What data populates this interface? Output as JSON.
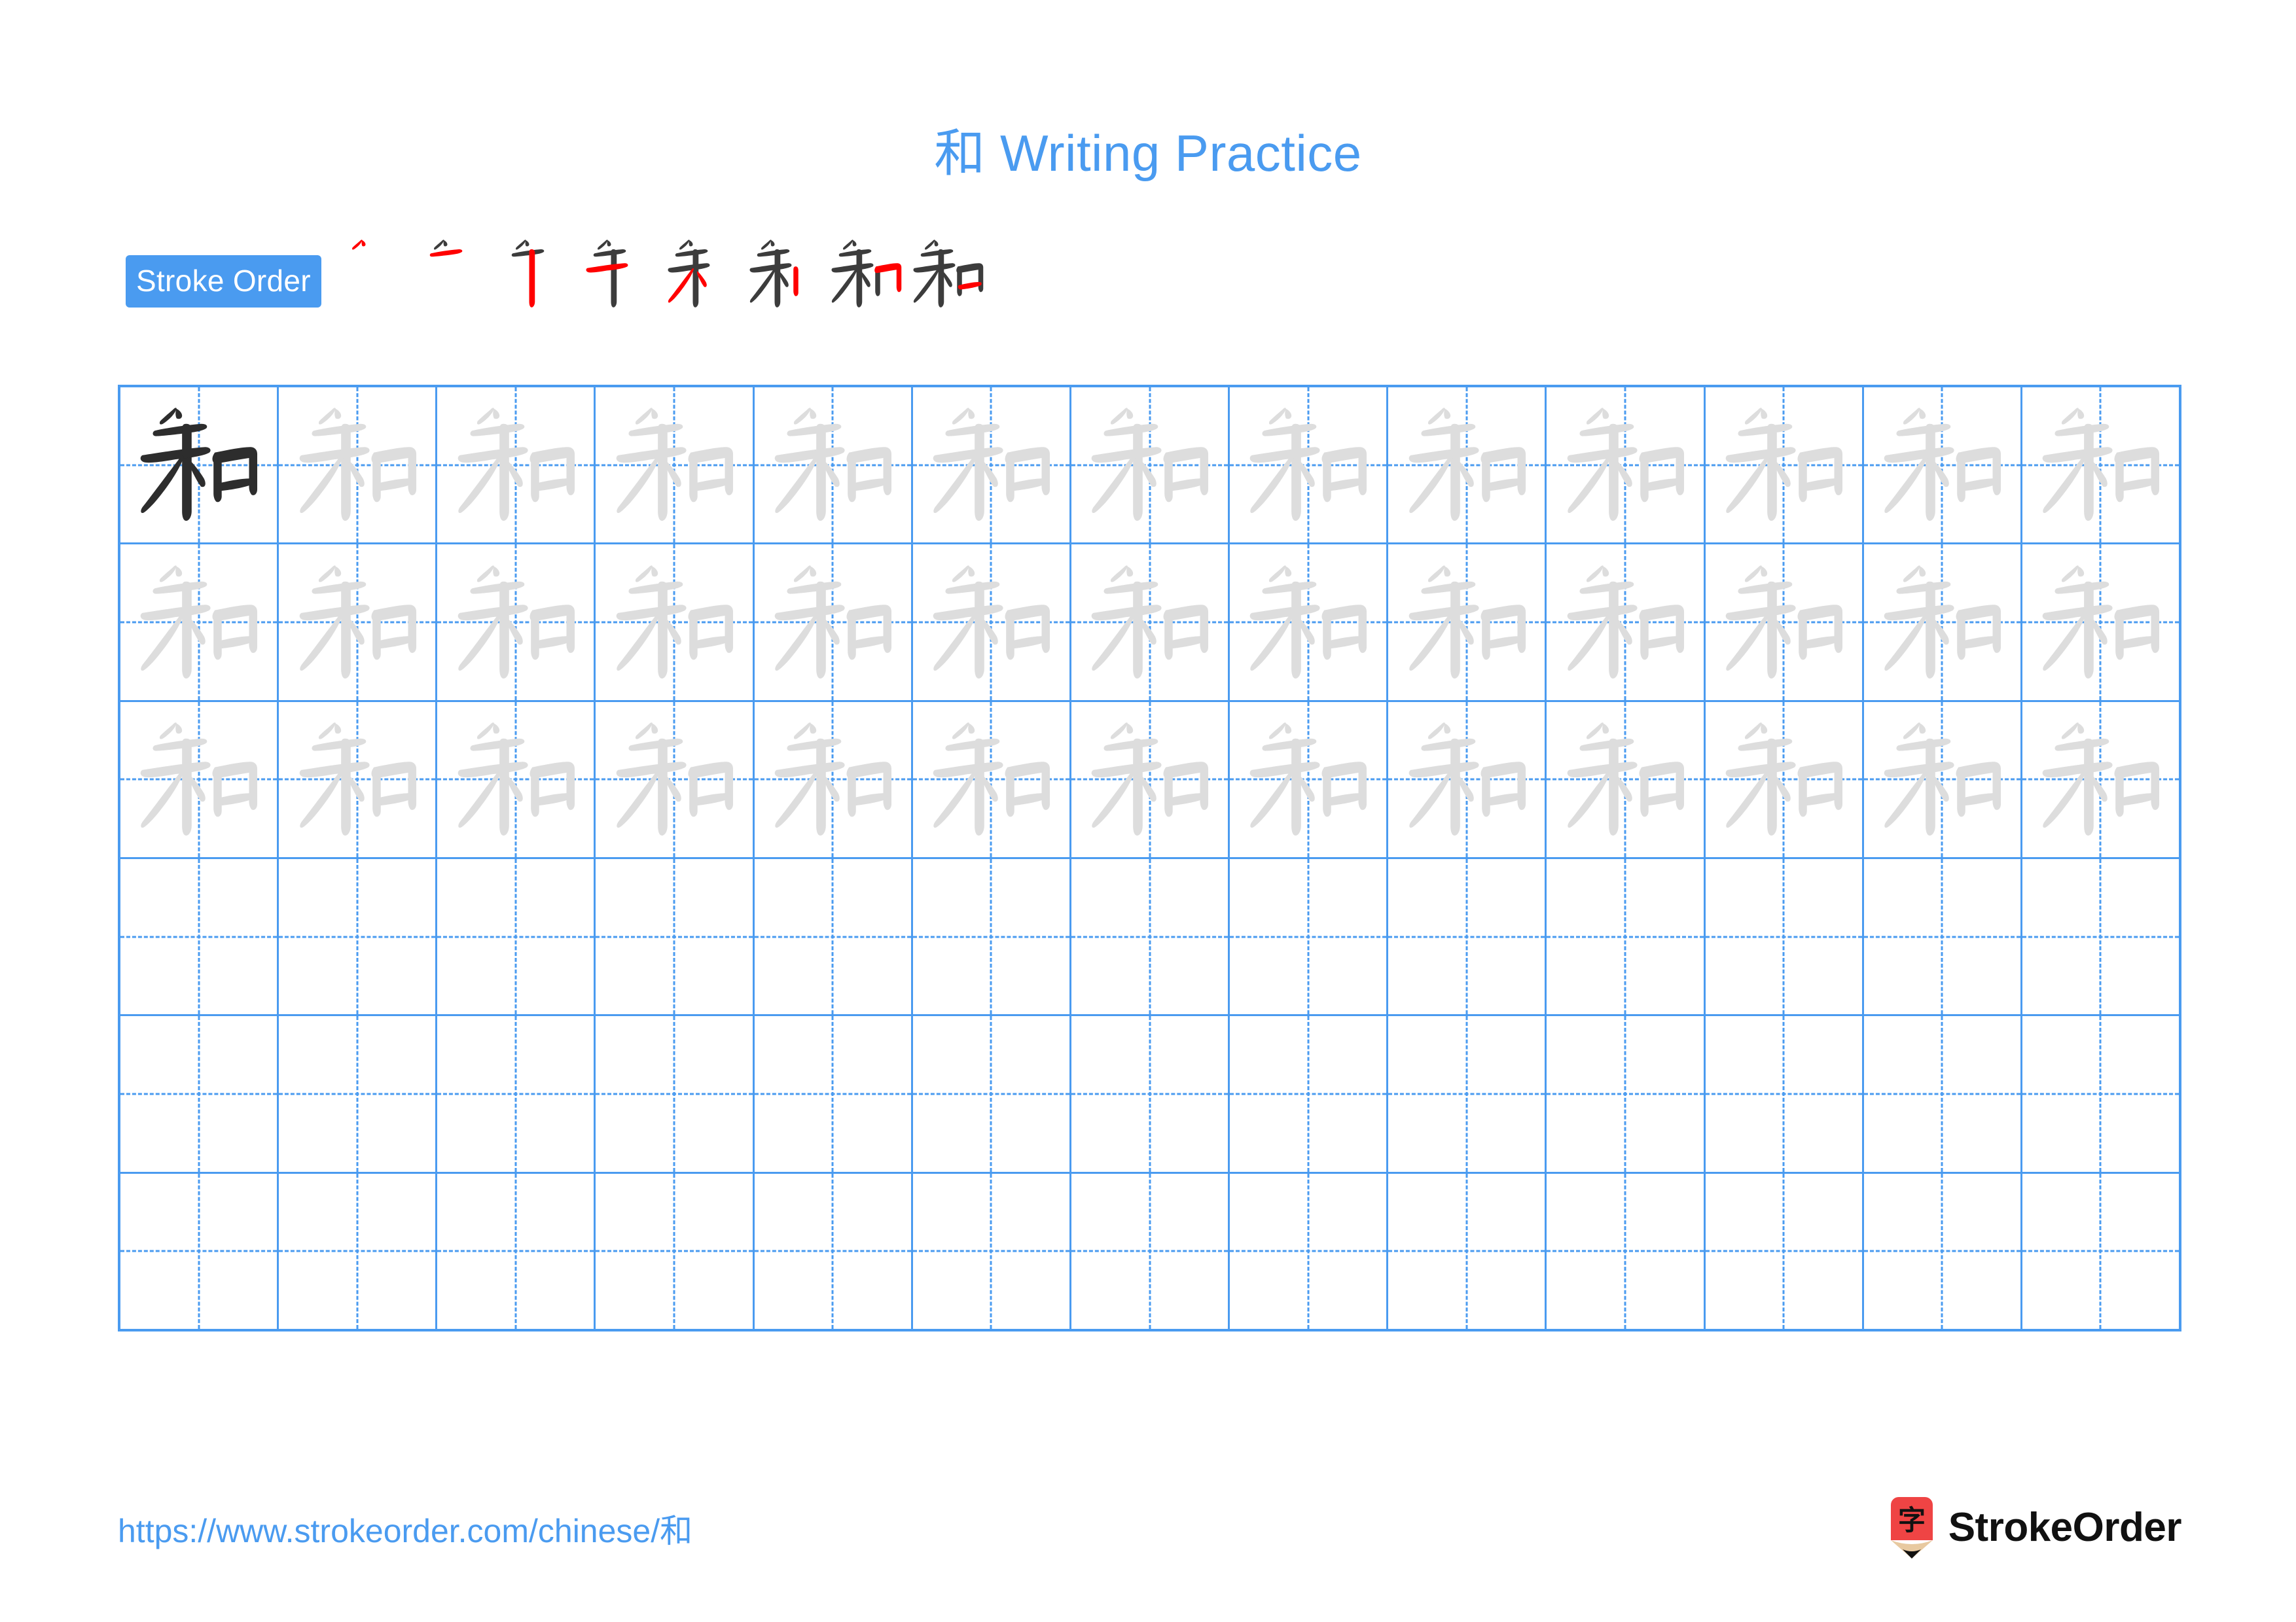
{
  "document": {
    "character": "和",
    "title": "和 Writing Practice",
    "title_color": "#4a9bf0",
    "background": "#ffffff"
  },
  "stroke_order": {
    "badge_label": "Stroke Order",
    "badge_bg": "#4a9bf0",
    "badge_text_color": "#ffffff",
    "total_strokes": 8,
    "completed_stroke_color": "#3c3c3c",
    "new_stroke_color": "#ff0000",
    "steps": [
      {
        "index": 1,
        "strokes_shown": 1,
        "new_stroke": "pie-diagonal-top"
      },
      {
        "index": 2,
        "strokes_shown": 2,
        "new_stroke": "heng-horizontal"
      },
      {
        "index": 3,
        "strokes_shown": 3,
        "new_stroke": "shu-vertical"
      },
      {
        "index": 4,
        "strokes_shown": 4,
        "new_stroke": "pie-left-falling"
      },
      {
        "index": 5,
        "strokes_shown": 5,
        "new_stroke": "na-right-falling"
      },
      {
        "index": 6,
        "strokes_shown": 6,
        "new_stroke": "kou-left-vertical"
      },
      {
        "index": 7,
        "strokes_shown": 7,
        "new_stroke": "kou-top-right-corner"
      },
      {
        "index": 8,
        "strokes_shown": 8,
        "new_stroke": "kou-bottom-horizontal"
      }
    ]
  },
  "practice_grid": {
    "columns": 13,
    "rows": 6,
    "grid_line_color": "#4a9bf0",
    "dark_glyph_color": "#2d2d2d",
    "trace_glyph_color": "#dddddd",
    "row_fill": [
      {
        "row": 1,
        "dark_cells": 1,
        "traced_cells": 12,
        "empty_cells": 0
      },
      {
        "row": 2,
        "dark_cells": 0,
        "traced_cells": 13,
        "empty_cells": 0
      },
      {
        "row": 3,
        "dark_cells": 0,
        "traced_cells": 13,
        "empty_cells": 0
      },
      {
        "row": 4,
        "dark_cells": 0,
        "traced_cells": 0,
        "empty_cells": 13
      },
      {
        "row": 5,
        "dark_cells": 0,
        "traced_cells": 0,
        "empty_cells": 13
      },
      {
        "row": 6,
        "dark_cells": 0,
        "traced_cells": 0,
        "empty_cells": 13
      }
    ]
  },
  "footer": {
    "url": "https://www.strokeorder.com/chinese/和",
    "url_color": "#4a9bf0",
    "brand_name": "StrokeOrder",
    "logo_character": "字",
    "logo_body_color": "#ef4444",
    "logo_wood_color": "#e8c9a0",
    "logo_tip_color": "#111111"
  }
}
